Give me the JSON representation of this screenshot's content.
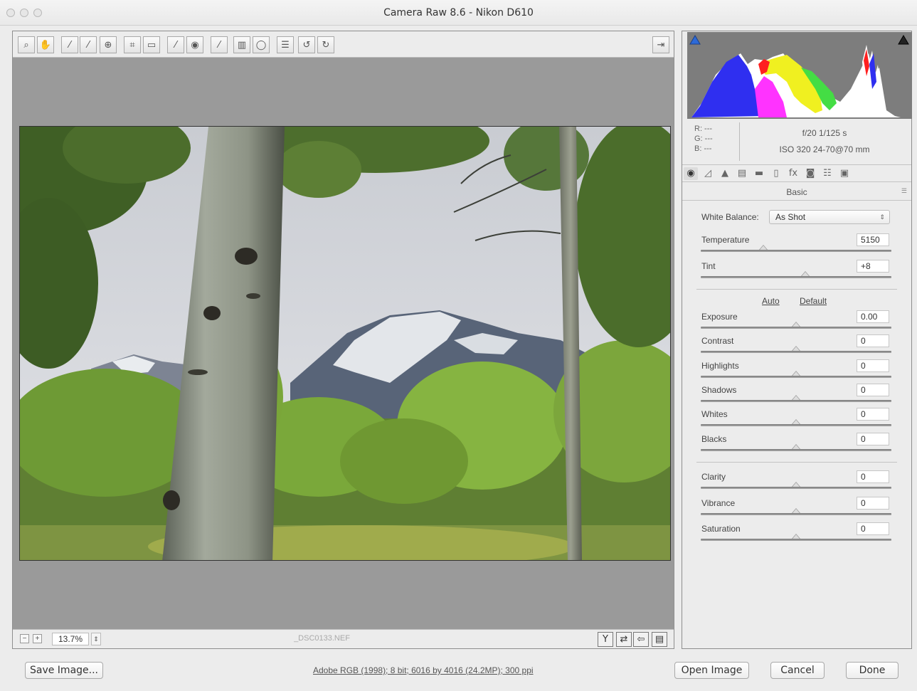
{
  "window": {
    "title": "Camera Raw 8.6 - Nikon D610"
  },
  "toolbar": {
    "tools": [
      {
        "icon": "zoom-icon",
        "glyph": "⌕"
      },
      {
        "icon": "hand-icon",
        "glyph": "✋"
      },
      {
        "icon": "white-balance-icon",
        "glyph": "⁄"
      },
      {
        "icon": "color-sampler-icon",
        "glyph": "⁄"
      },
      {
        "icon": "targeted-adjustment-icon",
        "glyph": "⊕"
      },
      {
        "icon": "crop-icon",
        "glyph": "⌗"
      },
      {
        "icon": "straighten-icon",
        "glyph": "▭"
      },
      {
        "icon": "spot-removal-icon",
        "glyph": "⁄"
      },
      {
        "icon": "red-eye-icon",
        "glyph": "◉"
      },
      {
        "icon": "adjustment-brush-icon",
        "glyph": "⁄"
      },
      {
        "icon": "graduated-filter-icon",
        "glyph": "▥"
      },
      {
        "icon": "radial-filter-icon",
        "glyph": "◯"
      },
      {
        "icon": "preferences-icon",
        "glyph": "☰"
      },
      {
        "icon": "rotate-left-icon",
        "glyph": "↺"
      },
      {
        "icon": "rotate-right-icon",
        "glyph": "↻"
      }
    ],
    "fullscreen_icon": "fullscreen-icon"
  },
  "statusbar": {
    "zoom": "13.7%",
    "filename": "_DSC0133.NEF",
    "view_buttons": [
      {
        "icon": "before-after-icon",
        "glyph": "Y"
      },
      {
        "icon": "swap-icon",
        "glyph": "⇄"
      },
      {
        "icon": "copy-settings-icon",
        "glyph": "⇦"
      },
      {
        "icon": "toggle-settings-icon",
        "glyph": "▤"
      }
    ]
  },
  "readout": {
    "r": "R:  ---",
    "g": "G:  ---",
    "b": "B:  ---",
    "exposure_line": "f/20   1/125 s",
    "lens_line": "ISO 320   24-70@70 mm"
  },
  "tabs": [
    {
      "icon": "basic-tab-icon",
      "glyph": "◉"
    },
    {
      "icon": "tone-curve-tab-icon",
      "glyph": "◿"
    },
    {
      "icon": "detail-tab-icon",
      "glyph": "▲"
    },
    {
      "icon": "hsl-tab-icon",
      "glyph": "▤"
    },
    {
      "icon": "split-toning-tab-icon",
      "glyph": "▬"
    },
    {
      "icon": "lens-corrections-tab-icon",
      "glyph": "▯"
    },
    {
      "icon": "effects-tab-icon",
      "glyph": "fx"
    },
    {
      "icon": "camera-calibration-tab-icon",
      "glyph": "◙"
    },
    {
      "icon": "presets-tab-icon",
      "glyph": "☷"
    },
    {
      "icon": "snapshots-tab-icon",
      "glyph": "▣"
    }
  ],
  "panel": {
    "title": "Basic",
    "white_balance_label": "White Balance:",
    "white_balance_value": "As Shot",
    "auto": "Auto",
    "default": "Default",
    "sliders": [
      {
        "label": "Temperature",
        "value": "5150",
        "level": 0.33
      },
      {
        "label": "Tint",
        "value": "+8",
        "level": 0.55
      },
      {
        "label": "Exposure",
        "value": "0.00",
        "level": 0.5
      },
      {
        "label": "Contrast",
        "value": "0",
        "level": 0.5
      },
      {
        "label": "Highlights",
        "value": "0",
        "level": 0.5
      },
      {
        "label": "Shadows",
        "value": "0",
        "level": 0.5
      },
      {
        "label": "Whites",
        "value": "0",
        "level": 0.5
      },
      {
        "label": "Blacks",
        "value": "0",
        "level": 0.5
      },
      {
        "label": "Clarity",
        "value": "0",
        "level": 0.5
      },
      {
        "label": "Vibrance",
        "value": "0",
        "level": 0.5
      },
      {
        "label": "Saturation",
        "value": "0",
        "level": 0.5
      }
    ]
  },
  "footer": {
    "save": "Save Image...",
    "workflow": "Adobe RGB (1998); 8 bit; 6016 by 4016 (24.2MP); 300 ppi",
    "open": "Open Image",
    "cancel": "Cancel",
    "done": "Done"
  },
  "colors": {
    "canvas": "#9a9a9a",
    "panel": "#ececec",
    "histogram_bg": "#7d7d7d"
  }
}
